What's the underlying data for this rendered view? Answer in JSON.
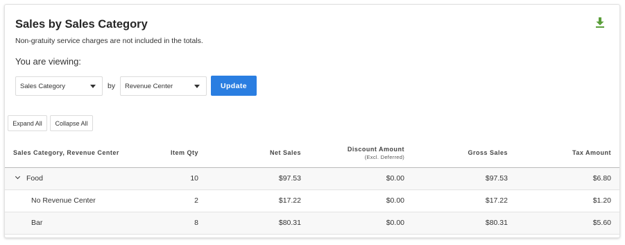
{
  "report": {
    "title": "Sales by Sales Category",
    "note": "Non-gratuity service charges are not included in the totals.",
    "viewing_label": "You are viewing:"
  },
  "filters": {
    "primary": "Sales Category",
    "by_label": "by",
    "secondary": "Revenue Center",
    "update_label": "Update"
  },
  "controls": {
    "expand_all": "Expand All",
    "collapse_all": "Collapse All"
  },
  "icons": {
    "download": "download-icon",
    "dropdown": "caret-down-icon",
    "expand": "chevron-down-icon"
  },
  "colors": {
    "accent": "#2a7ee1",
    "download": "#5a9e3a"
  },
  "table": {
    "columns": {
      "category": "Sales Category, Revenue Center",
      "item_qty": "Item Qty",
      "net_sales": "Net Sales",
      "discount": "Discount Amount",
      "discount_sub": "(Excl. Deferred)",
      "gross_sales": "Gross Sales",
      "tax": "Tax Amount"
    },
    "rows": [
      {
        "name": "Food",
        "item_qty": "10",
        "net_sales": "$97.53",
        "discount": "$0.00",
        "gross_sales": "$97.53",
        "tax": "$6.80"
      },
      {
        "name": "No Revenue Center",
        "item_qty": "2",
        "net_sales": "$17.22",
        "discount": "$0.00",
        "gross_sales": "$17.22",
        "tax": "$1.20"
      },
      {
        "name": "Bar",
        "item_qty": "8",
        "net_sales": "$80.31",
        "discount": "$0.00",
        "gross_sales": "$80.31",
        "tax": "$5.60"
      }
    ]
  }
}
